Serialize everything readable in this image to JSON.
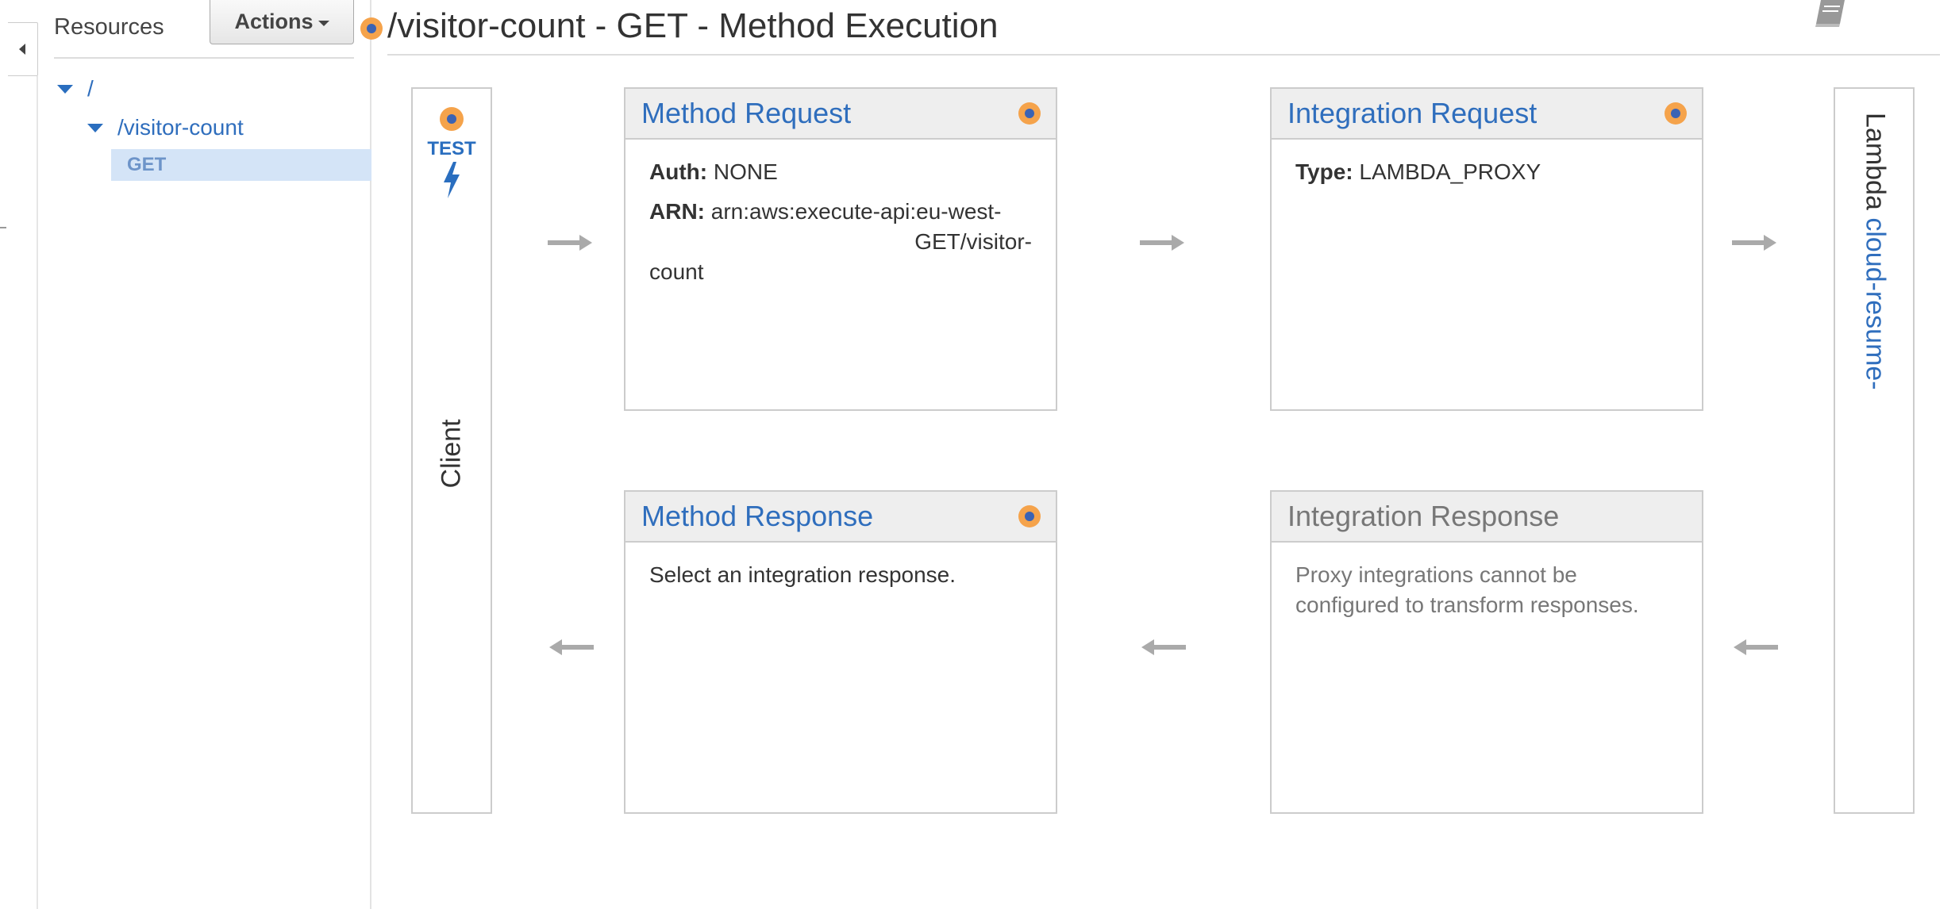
{
  "sidebar": {
    "title": "Resources",
    "actions_label": "Actions",
    "tree": [
      {
        "label": "/"
      },
      {
        "label": "/visitor-count"
      },
      {
        "label": "GET"
      }
    ]
  },
  "header": {
    "title": "/visitor-count - GET - Method Execution"
  },
  "client": {
    "test_label": "TEST",
    "label": "Client"
  },
  "method_request": {
    "title": "Method Request",
    "auth_label": "Auth:",
    "auth_value": "NONE",
    "arn_label": "ARN:",
    "arn_line1": "arn:aws:execute-api:eu-west-",
    "arn_line2": "GET/visitor-",
    "arn_line3": "count"
  },
  "integration_request": {
    "title": "Integration Request",
    "type_label": "Type:",
    "type_value": "LAMBDA_PROXY"
  },
  "method_response": {
    "title": "Method Response",
    "body": "Select an integration response."
  },
  "integration_response": {
    "title": "Integration Response",
    "body": "Proxy integrations cannot be configured to transform responses."
  },
  "lambda": {
    "prefix": "Lambda",
    "name": "cloud-resume-"
  },
  "colors": {
    "link_blue": "#2f6ebd",
    "selected_row": "#d4e4f7",
    "dot_orange": "#f5a34b",
    "dot_blue": "#3b63b4",
    "arrow_grey": "#aaaaaa"
  },
  "icons": {
    "collapse": "chevron-left-icon",
    "doc": "book-icon",
    "test": "lightning-icon",
    "status_dot": "orange-dot-icon"
  }
}
